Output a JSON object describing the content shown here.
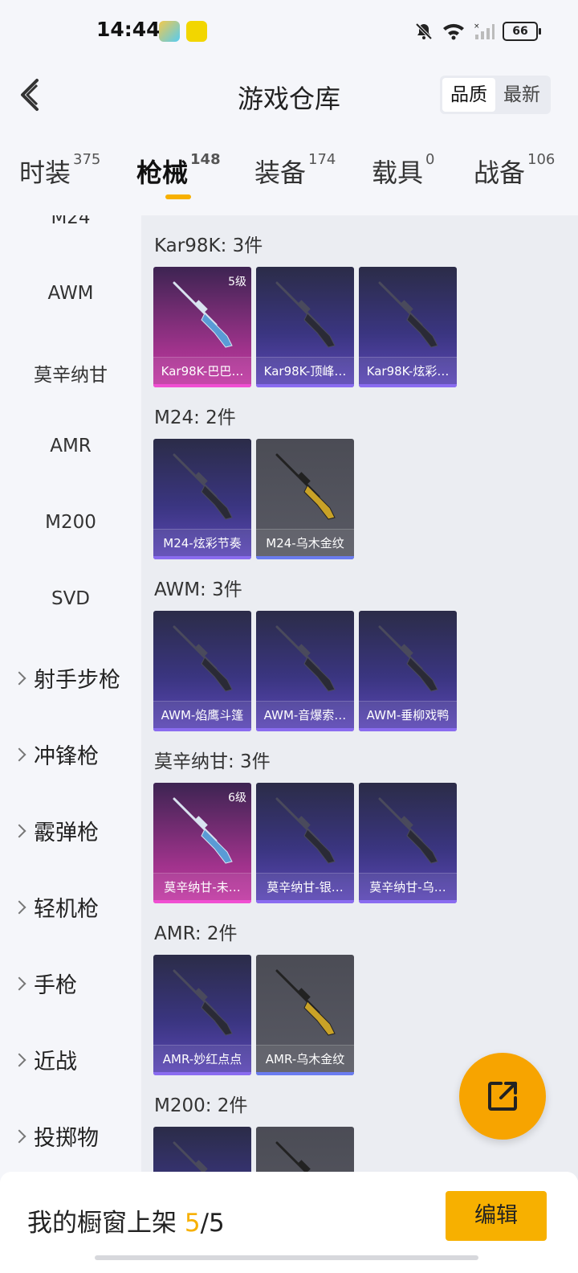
{
  "status_bar": {
    "time": "14:44",
    "battery": "66"
  },
  "header": {
    "title": "游戏仓库",
    "sort_options": [
      "品质",
      "最新"
    ],
    "active_sort": "品质"
  },
  "tabs": [
    {
      "label": "时装",
      "count": "375"
    },
    {
      "label": "枪械",
      "count": "148",
      "active": true
    },
    {
      "label": "装备",
      "count": "174"
    },
    {
      "label": "载具",
      "count": "0"
    },
    {
      "label": "战备",
      "count": "106"
    }
  ],
  "sidebar": {
    "sub_items": [
      "M24",
      "AWM",
      "莫辛纳甘",
      "AMR",
      "M200",
      "SVD"
    ],
    "categories": [
      "射手步枪",
      "冲锋枪",
      "霰弹枪",
      "轻机枪",
      "手枪",
      "近战",
      "投掷物"
    ]
  },
  "groups": [
    {
      "title": "Kar98K: 3件",
      "items": [
        {
          "name": "Kar98K-巴巴…",
          "level": "5级",
          "rarity": "pink"
        },
        {
          "name": "Kar98K-顶峰…",
          "rarity": "purple"
        },
        {
          "name": "Kar98K-炫彩…",
          "rarity": "purple"
        }
      ]
    },
    {
      "title": "M24: 2件",
      "items": [
        {
          "name": "M24-炫彩节奏",
          "rarity": "purple"
        },
        {
          "name": "M24-乌木金纹",
          "rarity": "gray"
        }
      ]
    },
    {
      "title": "AWM: 3件",
      "items": [
        {
          "name": "AWM-焰鹰斗篷",
          "rarity": "purple"
        },
        {
          "name": "AWM-音爆索…",
          "rarity": "purple"
        },
        {
          "name": "AWM-垂柳戏鸭",
          "rarity": "purple"
        }
      ]
    },
    {
      "title": "莫辛纳甘: 3件",
      "items": [
        {
          "name": "莫辛纳甘-未…",
          "level": "6级",
          "rarity": "pink"
        },
        {
          "name": "莫辛纳甘-银…",
          "rarity": "purple"
        },
        {
          "name": "莫辛纳甘-乌…",
          "rarity": "purple"
        }
      ]
    },
    {
      "title": "AMR: 2件",
      "items": [
        {
          "name": "AMR-妙红点点",
          "rarity": "purple"
        },
        {
          "name": "AMR-乌木金纹",
          "rarity": "gray"
        }
      ]
    },
    {
      "title": "M200: 2件",
      "items": [
        {
          "name": "",
          "rarity": "purple"
        },
        {
          "name": "",
          "rarity": "gray"
        }
      ]
    }
  ],
  "bottom": {
    "showcase_label": "我的橱窗上架",
    "showcase_current": "5",
    "showcase_total": "/5",
    "edit_label": "编辑"
  },
  "colors": {
    "accent": "#f7b000",
    "fab": "#f7a400"
  }
}
